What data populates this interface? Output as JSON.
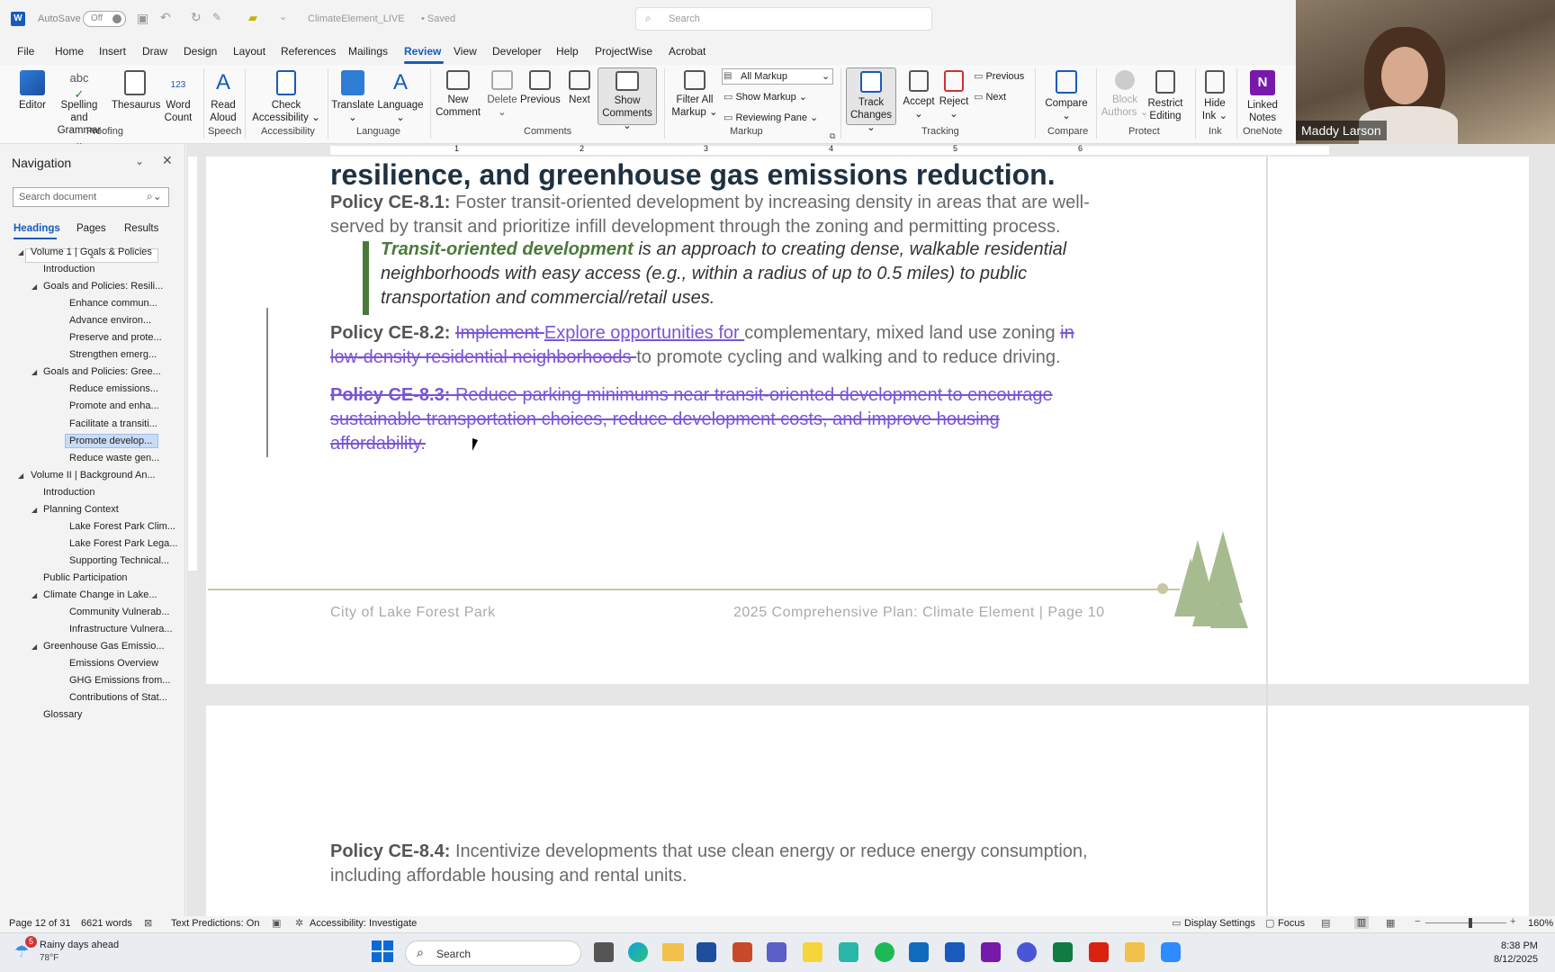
{
  "titlebar": {
    "autosave_label": "AutoSave",
    "autosave_state": "Off",
    "doc_title": "ClimateElement_LIVE",
    "saved_status": "• Saved",
    "search_placeholder": "Search"
  },
  "menu": [
    "File",
    "Home",
    "Insert",
    "Draw",
    "Design",
    "Layout",
    "References",
    "Mailings",
    "Review",
    "View",
    "Developer",
    "Help",
    "ProjectWise",
    "Acrobat"
  ],
  "menu_active": "Review",
  "ribbon": {
    "proofing": {
      "label": "Proofing",
      "editor": "Editor",
      "spelling": "Spelling and",
      "spelling2": "Grammar",
      "thesaurus": "Thesaurus",
      "wordcount": "Word",
      "wordcount2": "Count",
      "abc": "abc",
      "num": "123"
    },
    "speech": {
      "label": "Speech",
      "read": "Read",
      "read2": "Aloud"
    },
    "accessibility": {
      "label": "Accessibility",
      "check": "Check",
      "check2": "Accessibility"
    },
    "language": {
      "label": "Language",
      "translate": "Translate",
      "language": "Language"
    },
    "comments": {
      "label": "Comments",
      "new": "New",
      "new2": "Comment",
      "delete": "Delete",
      "previous": "Previous",
      "next": "Next",
      "show": "Show",
      "show2": "Comments"
    },
    "markup": {
      "label": "Markup",
      "filter": "Filter All",
      "filter2": "Markup",
      "select_value": "All Markup",
      "show_markup": "Show Markup",
      "reviewing_pane": "Reviewing Pane"
    },
    "tracking": {
      "label": "Tracking",
      "track": "Track",
      "track2": "Changes",
      "accept": "Accept",
      "reject": "Reject",
      "previous": "Previous",
      "next": "Next"
    },
    "compare": {
      "label": "Compare",
      "compare": "Compare"
    },
    "protect": {
      "label": "Protect",
      "block": "Block",
      "block2": "Authors",
      "restrict": "Restrict",
      "restrict2": "Editing"
    },
    "ink": {
      "label": "Ink",
      "hide": "Hide",
      "hide2": "Ink"
    },
    "onenote": {
      "label": "OneNote",
      "linked": "Linked",
      "linked2": "Notes"
    }
  },
  "video": {
    "participant": "Maddy Larson"
  },
  "nav": {
    "title": "Navigation",
    "search_placeholder": "Search document",
    "tabs": [
      "Headings",
      "Pages",
      "Results"
    ],
    "items": [
      {
        "label": "Volume 1 | Goals & Policies",
        "level": 0,
        "tri": true
      },
      {
        "label": "Introduction",
        "level": 1,
        "tri": false
      },
      {
        "label": "Goals and Policies: Resili...",
        "level": 1,
        "tri": true
      },
      {
        "label": "Enhance commun...",
        "level": 2,
        "tri": false
      },
      {
        "label": "Advance environ...",
        "level": 2,
        "tri": false
      },
      {
        "label": "Preserve and prote...",
        "level": 2,
        "tri": false
      },
      {
        "label": "Strengthen emerg...",
        "level": 2,
        "tri": false
      },
      {
        "label": "Goals and Policies: Gree...",
        "level": 1,
        "tri": true
      },
      {
        "label": "Reduce emissions...",
        "level": 2,
        "tri": false
      },
      {
        "label": "Promote and enha...",
        "level": 2,
        "tri": false
      },
      {
        "label": "Facilitate a transiti...",
        "level": 2,
        "tri": false
      },
      {
        "label": "Promote develop...",
        "level": 2,
        "tri": false,
        "selected": true
      },
      {
        "label": "Reduce waste gen...",
        "level": 2,
        "tri": false
      },
      {
        "label": "Volume II | Background An...",
        "level": 0,
        "tri": true
      },
      {
        "label": "Introduction",
        "level": 1,
        "tri": false
      },
      {
        "label": "Planning Context",
        "level": 1,
        "tri": true
      },
      {
        "label": "Lake Forest Park Clim...",
        "level": 2,
        "tri": false
      },
      {
        "label": "Lake Forest Park Lega...",
        "level": 2,
        "tri": false
      },
      {
        "label": "Supporting Technical...",
        "level": 2,
        "tri": false
      },
      {
        "label": "Public Participation",
        "level": 1,
        "tri": false
      },
      {
        "label": "Climate Change in Lake...",
        "level": 1,
        "tri": true
      },
      {
        "label": "Community Vulnerab...",
        "level": 2,
        "tri": false
      },
      {
        "label": "Infrastructure Vulnera...",
        "level": 2,
        "tri": false
      },
      {
        "label": "Greenhouse Gas Emissio...",
        "level": 1,
        "tri": true
      },
      {
        "label": "Emissions Overview",
        "level": 2,
        "tri": false
      },
      {
        "label": "GHG Emissions from...",
        "level": 2,
        "tri": false
      },
      {
        "label": "Contributions of Stat...",
        "level": 2,
        "tri": false
      },
      {
        "label": "Glossary",
        "level": 1,
        "tri": false
      }
    ]
  },
  "ruler": [
    "1",
    "2",
    "3",
    "4",
    "5",
    "6"
  ],
  "doc": {
    "heading": "resilience, and greenhouse gas emissions reduction.",
    "p81_label": "Policy CE-8.1:",
    "p81_text1": " Foster transit-oriented development by increasing density in areas that are well-",
    "p81_text2": "served by transit and prioritize infill development through the zoning and permitting process.",
    "callout_term": "Transit-oriented development",
    "callout_1": " is an approach to creating dense, walkable residential",
    "callout_2": "neighborhoods with easy access (e.g., within a radius of up to 0.5 miles) to public",
    "callout_3": "transportation and commercial/retail uses.",
    "p82_label": "Policy CE-8.2:",
    "p82_del1": "Implement ",
    "p82_ins1": "Explore opportunities for ",
    "p82_text1": "complementary, mixed land use zoning ",
    "p82_del2": "in",
    "p82_del3": "low-density residential neighborhoods ",
    "p82_text2": "to promote cycling and walking and to reduce driving.",
    "p83_label": "Policy CE-8.3:",
    "p83_1": " Reduce parking minimums near transit-oriented development to encourage",
    "p83_2": "sustainable transportation choices, reduce development costs, and improve housing",
    "p83_3": "affordability.",
    "footer_left": "City of Lake Forest Park",
    "footer_right": "2025 Comprehensive Plan: Climate Element | Page 10",
    "p84_label": "Policy CE-8.4:",
    "p84_1": " Incentivize developments that use clean energy or reduce energy consumption,",
    "p84_2": "including affordable housing and rental units."
  },
  "status": {
    "page": "Page 12 of 31",
    "words": "6621 words",
    "predictions": "Text Predictions: On",
    "accessibility": "Accessibility: Investigate",
    "display": "Display Settings",
    "focus": "Focus",
    "zoom": "160%"
  },
  "taskbar": {
    "weather_title": "Rainy days ahead",
    "weather_temp": "78°F",
    "search": "Search",
    "time": "8:38 PM",
    "date": "8/12/2025",
    "badge": "5"
  },
  "colors": {
    "accent": "#185abd",
    "track_change": "#7b54d6",
    "callout_green": "#4a7a3a",
    "heading": "#1f3140"
  }
}
